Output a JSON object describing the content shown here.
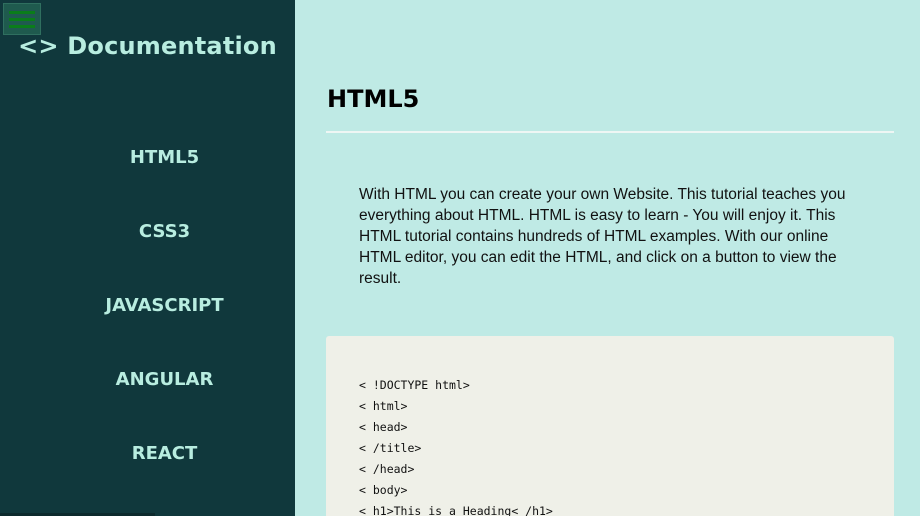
{
  "sidebar": {
    "menu_icon": "hamburger-icon",
    "brand": "<> Documentation",
    "items": [
      {
        "label": "HTML5"
      },
      {
        "label": "CSS3"
      },
      {
        "label": "JAVASCRIPT"
      },
      {
        "label": "ANGULAR"
      },
      {
        "label": "REACT"
      }
    ]
  },
  "main": {
    "title": "HTML5",
    "intro": "With HTML you can create your own Website. This tutorial teaches you everything about HTML. HTML is easy to learn - You will enjoy it. This HTML tutorial contains hundreds of HTML examples. With our online HTML editor, you can edit the HTML, and click on a button to view the result.",
    "code_lines": [
      "< !DOCTYPE html>",
      "< html>",
      "< head>",
      "< /title>",
      "< /head>",
      "< body>",
      "< h1>This is a Heading< /h1>"
    ]
  },
  "colors": {
    "sidebar_bg": "#10383c",
    "main_bg": "#bfeae5",
    "nav_text": "#b8ede0",
    "code_bg": "#eff0e8"
  }
}
